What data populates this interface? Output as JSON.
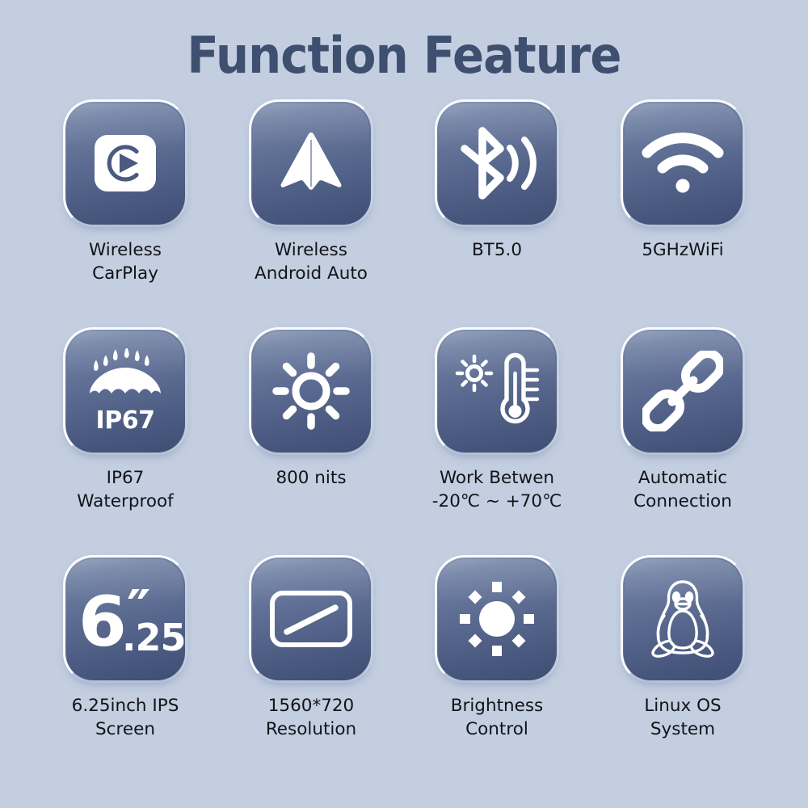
{
  "page": {
    "title": "Function Feature",
    "background_color": "#c3cee0",
    "title_color": "#3f4f70",
    "tile_gradient_top": "#8595b4",
    "tile_gradient_bottom": "#3f4e74",
    "caption_color": "#111418",
    "icon_color": "#ffffff"
  },
  "features": [
    {
      "icon": "carplay-icon",
      "line1": "Wireless",
      "line2": "CarPlay"
    },
    {
      "icon": "android-auto-icon",
      "line1": "Wireless",
      "line2": "Android Auto"
    },
    {
      "icon": "bluetooth-icon",
      "line1": "BT5.0",
      "line2": ""
    },
    {
      "icon": "wifi-icon",
      "line1": "5GHzWiFi",
      "line2": ""
    },
    {
      "icon": "umbrella-waterproof-icon",
      "icon_text": "IP67",
      "line1": "IP67",
      "line2": "Waterproof"
    },
    {
      "icon": "sun-rays-icon",
      "line1": "800 nits",
      "line2": ""
    },
    {
      "icon": "thermometer-sun-icon",
      "line1": "Work Betwen",
      "line2": "-20℃ ~ +70℃"
    },
    {
      "icon": "chain-link-icon",
      "line1": "Automatic",
      "line2": "Connection"
    },
    {
      "icon": "screen-size-icon",
      "icon_number": "6",
      "icon_inch_marks": "″",
      "icon_decimal": ".25",
      "line1": "6.25inch IPS",
      "line2": "Screen"
    },
    {
      "icon": "display-resolution-icon",
      "line1": "1560*720",
      "line2": "Resolution"
    },
    {
      "icon": "brightness-icon",
      "line1": "Brightness",
      "line2": "Control"
    },
    {
      "icon": "linux-penguin-icon",
      "line1": "Linux OS",
      "line2": "System"
    }
  ]
}
